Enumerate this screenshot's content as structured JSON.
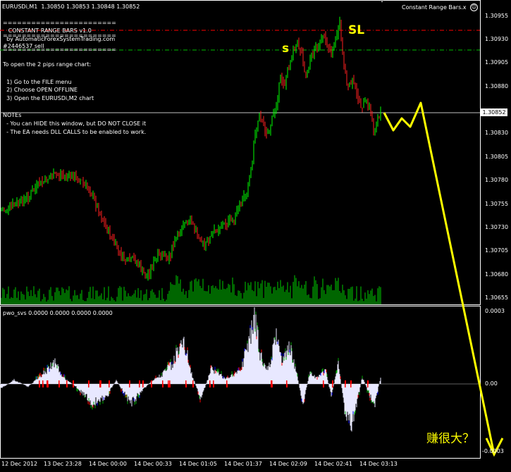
{
  "header": {
    "symbol_info": "EURUSDi,M1  1.30850 1.30853 1.30848 1.30852",
    "ea_name": "Constant Range Bars.x"
  },
  "overlay": {
    "sep1": "========================",
    "title": "   CONSTANT RANGE BARS v1.0",
    "sep2": "========================",
    "by": "  by AutomaticForexSystemTrading.com",
    "id": "#2446537 sell",
    "sep3": "========================",
    "instr_head": "To open the 2 pips range chart:",
    "step1": "  1) Go to the FILE menu",
    "step2": "  2) Choose OPEN OFFLINE",
    "step3": "  3) Open the EURUSDi,M2 chart",
    "notes_head": "NOTEs",
    "note1": "  - You can HIDE this window, but DO NOT CLOSE it",
    "note2": "  - The EA needs DLL CALLS to be enabled to work."
  },
  "annotations": {
    "sl": "SL",
    "s": "s",
    "cjk": "赚很大？"
  },
  "price_axis": {
    "labels": [
      "1.30955",
      "1.30930",
      "1.30905",
      "1.30880",
      "1.30830",
      "1.30805",
      "1.30780",
      "1.30755",
      "1.30730",
      "1.30705",
      "1.30680",
      "1.30655"
    ],
    "current": "1.30852"
  },
  "indicator": {
    "label": "pwo_svs 0.0000 0.0000 0.0000 0.0000",
    "axis_top": "0.0003",
    "axis_mid": "0.00",
    "axis_bottom": "-0.0003"
  },
  "time_axis": [
    "12 Dec 2012",
    "13 Dec 23:28",
    "14 Dec 00:00",
    "14 Dec 00:33",
    "14 Dec 01:05",
    "14 Dec 01:37",
    "14 Dec 02:09",
    "14 Dec 02:41",
    "14 Dec 03:13"
  ],
  "colors": {
    "bull": "#00ff00",
    "bear": "#ff2020",
    "volume": "#00cc00",
    "sl_line": "#ff0000",
    "entry_line": "#00cc00",
    "drawing": "#ffff00",
    "hist_main": "#e8e8ff",
    "hist_green": "#00aa00",
    "hist_blue": "#0000ff",
    "hist_red": "#ff0000"
  }
}
